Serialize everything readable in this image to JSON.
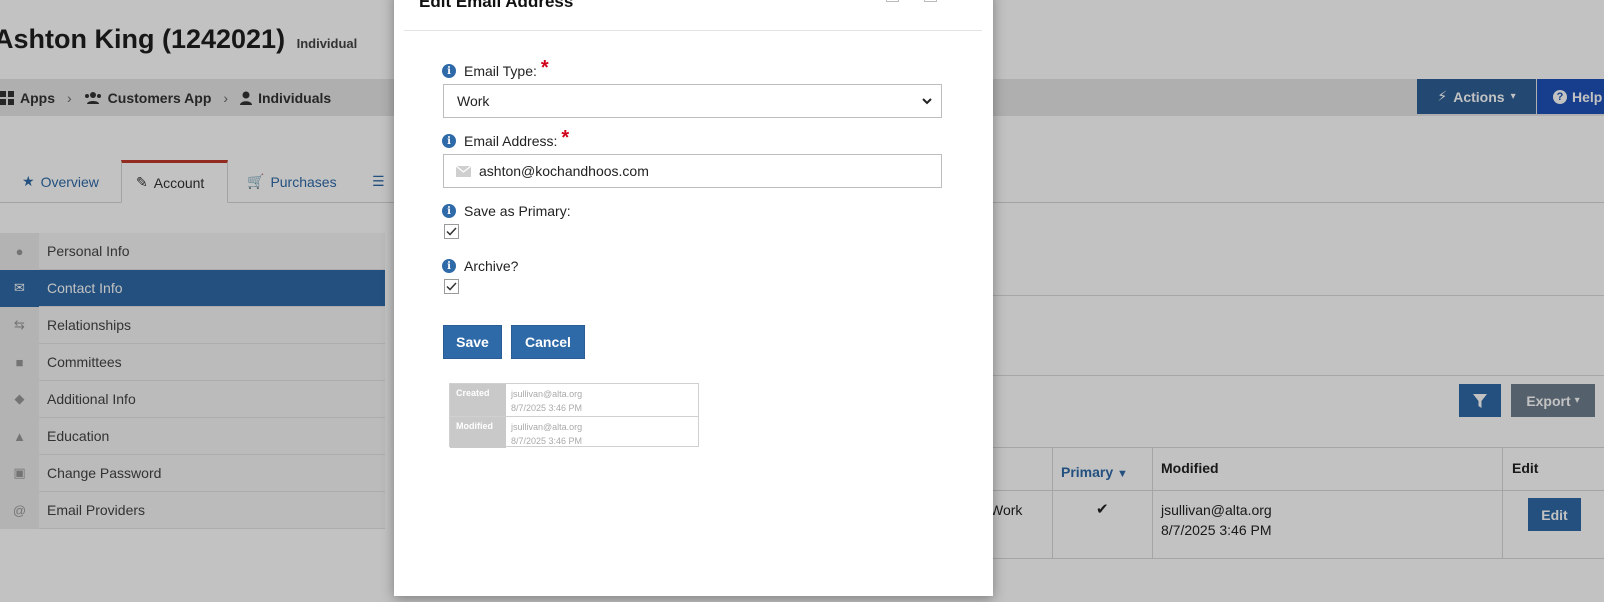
{
  "page": {
    "title": "Ashton King (1242021)",
    "subtitle": "Individual",
    "breadcrumb": [
      "Apps",
      "Customers App",
      "Individuals"
    ],
    "actions_label": "Actions",
    "help_label": "Help"
  },
  "tabs": [
    {
      "label": "Overview",
      "icon": "star-icon"
    },
    {
      "label": "Account",
      "icon": "edit-icon",
      "active": true
    },
    {
      "label": "Purchases",
      "icon": "cart-icon"
    }
  ],
  "side_nav": [
    {
      "label": "Personal Info",
      "icon": "user-icon"
    },
    {
      "label": "Contact Info",
      "icon": "envelope-icon",
      "active": true
    },
    {
      "label": "Relationships",
      "icon": "retweet-icon"
    },
    {
      "label": "Committees",
      "icon": "briefcase-icon"
    },
    {
      "label": "Additional Info",
      "icon": "tags-icon"
    },
    {
      "label": "Education",
      "icon": "graduation-cap-icon"
    },
    {
      "label": "Change Password",
      "icon": "lock-icon"
    },
    {
      "label": "Email Providers",
      "icon": "at-icon"
    }
  ],
  "grid": {
    "export_label": "Export",
    "columns": [
      "Primary",
      "Modified",
      "Edit"
    ],
    "row": {
      "type_partial": "Work",
      "modified_by": "jsullivan@alta.org",
      "modified_at": "8/7/2025 3:46 PM",
      "edit_label": "Edit"
    }
  },
  "modal": {
    "title": "Edit Email Address",
    "email_type_label": "Email Type:",
    "email_type_value": "Work",
    "email_address_label": "Email Address:",
    "email_address_value": "ashton@kochandhoos.com",
    "save_primary_label": "Save as Primary:",
    "save_primary_checked": true,
    "archive_label": "Archive?",
    "archive_checked": true,
    "save_label": "Save",
    "cancel_label": "Cancel",
    "audit": {
      "created_label": "Created",
      "created_by": "jsullivan@alta.org",
      "created_at": "8/7/2025 3:46 PM",
      "modified_label": "Modified",
      "modified_by": "jsullivan@alta.org",
      "modified_at": "8/7/2025 3:46 PM"
    }
  },
  "colors": {
    "primary_blue": "#2f6aa8",
    "help_blue": "#1e52b8",
    "required_red": "#d0021b",
    "tab_accent": "#c0392b"
  }
}
